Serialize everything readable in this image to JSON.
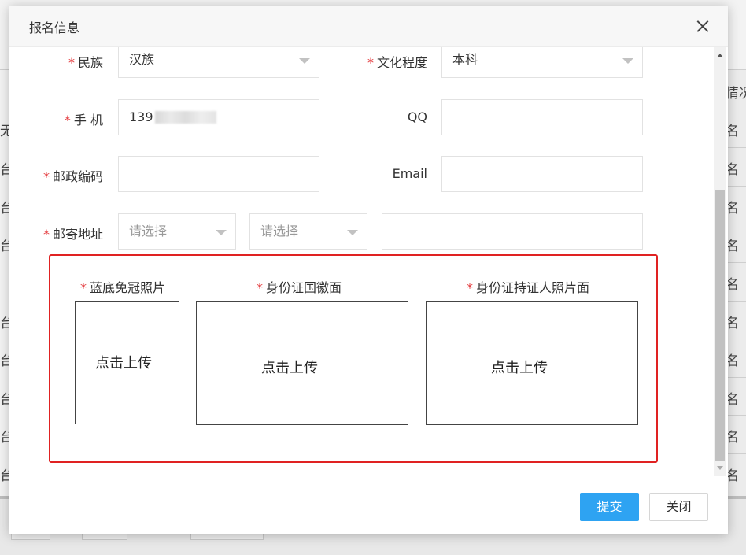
{
  "background": {
    "right_header": "情况",
    "right_cells": [
      "名",
      "名",
      "名",
      "名",
      "名",
      "名",
      "名",
      "名",
      "名",
      "名"
    ],
    "left_cells": [
      "无",
      "台",
      "台",
      "台",
      "台",
      "台",
      "台",
      "台",
      "台"
    ]
  },
  "modal": {
    "title": "报名信息",
    "close_icon": "close-icon"
  },
  "form": {
    "required_mark": "*",
    "ethnicity": {
      "label": "民族",
      "value": "汉族"
    },
    "education": {
      "label": "文化程度",
      "value": "本科"
    },
    "phone": {
      "label": "手 机",
      "value": "139"
    },
    "qq": {
      "label": "QQ",
      "value": ""
    },
    "postcode": {
      "label": "邮政编码",
      "value": ""
    },
    "email": {
      "label": "Email",
      "value": ""
    },
    "address": {
      "label": "邮寄地址",
      "province_placeholder": "请选择",
      "city_placeholder": "请选择",
      "detail": ""
    }
  },
  "uploads": [
    {
      "label": "蓝底免冠照片",
      "button": "点击上传"
    },
    {
      "label": "身份证国徽面",
      "button": "点击上传"
    },
    {
      "label": "身份证持证人照片面",
      "button": "点击上传"
    }
  ],
  "footer": {
    "submit": "提交",
    "close": "关闭"
  },
  "colors": {
    "primary": "#2ea3f2",
    "required": "#e4393c",
    "highlight_frame": "#e02222"
  }
}
